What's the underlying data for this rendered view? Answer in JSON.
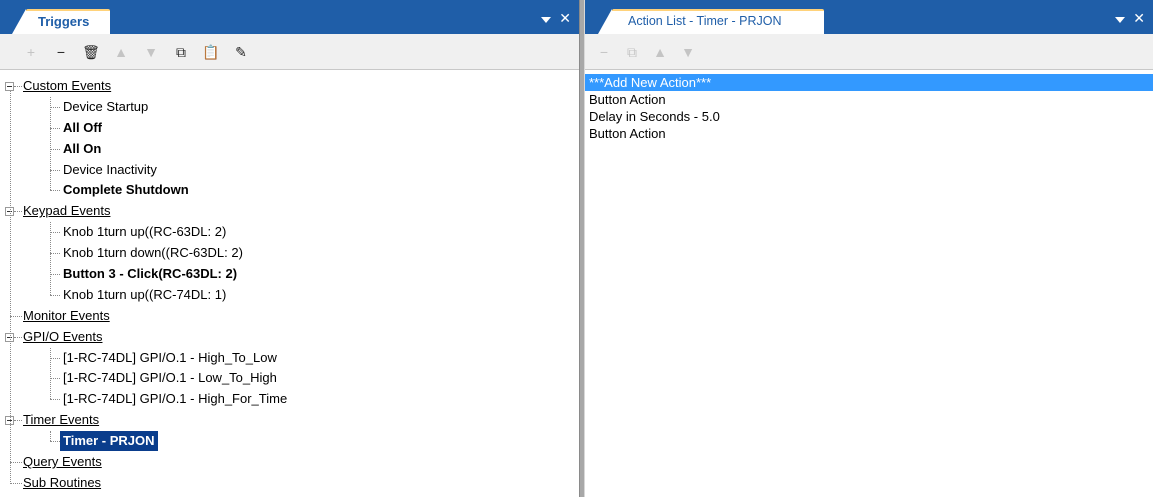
{
  "left_panel": {
    "tab_title": "Triggers",
    "toolbar": [
      {
        "name": "add-icon",
        "glyph": "+",
        "enabled": false
      },
      {
        "name": "remove-icon",
        "glyph": "−",
        "enabled": true
      },
      {
        "name": "delete-icon",
        "glyph": "🗑",
        "enabled": true
      },
      {
        "name": "move-up-icon",
        "glyph": "▲",
        "enabled": false
      },
      {
        "name": "move-down-icon",
        "glyph": "▼",
        "enabled": false
      },
      {
        "name": "copy-icon",
        "glyph": "⧉",
        "enabled": true
      },
      {
        "name": "paste-icon",
        "glyph": "📋",
        "enabled": false
      },
      {
        "name": "edit-icon",
        "glyph": "✎",
        "enabled": true
      }
    ],
    "tree": [
      {
        "label": "Custom Events",
        "children": [
          {
            "label": "Device Startup",
            "bold": false
          },
          {
            "label": "All Off",
            "bold": true
          },
          {
            "label": "All On",
            "bold": true
          },
          {
            "label": "Device Inactivity",
            "bold": false
          },
          {
            "label": "Complete Shutdown",
            "bold": true
          }
        ]
      },
      {
        "label": "Keypad Events",
        "children": [
          {
            "label": "Knob 1turn up((RC-63DL: 2)",
            "bold": false
          },
          {
            "label": "Knob 1turn down((RC-63DL: 2)",
            "bold": false
          },
          {
            "label": "Button 3 - Click(RC-63DL: 2)",
            "bold": true
          },
          {
            "label": "Knob 1turn up((RC-74DL: 1)",
            "bold": false
          }
        ]
      },
      {
        "label": "Monitor Events",
        "children": []
      },
      {
        "label": "GPI/O Events",
        "children": [
          {
            "label": "[1-RC-74DL] GPI/O.1 - High_To_Low",
            "bold": false
          },
          {
            "label": "[1-RC-74DL] GPI/O.1 - Low_To_High",
            "bold": false
          },
          {
            "label": "[1-RC-74DL] GPI/O.1 - High_For_Time",
            "bold": false
          }
        ]
      },
      {
        "label": "Timer Events",
        "children": [
          {
            "label": "Timer - PRJON",
            "bold": true,
            "selected": true
          }
        ]
      },
      {
        "label": "Query Events",
        "children": []
      },
      {
        "label": "Sub Routines",
        "children": []
      }
    ]
  },
  "right_panel": {
    "tab_title": "Action List - Timer - PRJON",
    "toolbar": [
      {
        "name": "remove-action-icon",
        "glyph": "−",
        "enabled": false
      },
      {
        "name": "copy-action-icon",
        "glyph": "⧉",
        "enabled": false
      },
      {
        "name": "move-action-up-icon",
        "glyph": "▲",
        "enabled": false
      },
      {
        "name": "move-action-down-icon",
        "glyph": "▼",
        "enabled": false
      }
    ],
    "actions": [
      {
        "label": "***Add New Action***",
        "selected": true
      },
      {
        "label": "Button Action",
        "selected": false
      },
      {
        "label": "Delay in Seconds - 5.0",
        "selected": false
      },
      {
        "label": "Button Action",
        "selected": false
      }
    ]
  },
  "close_glyph": "✕"
}
